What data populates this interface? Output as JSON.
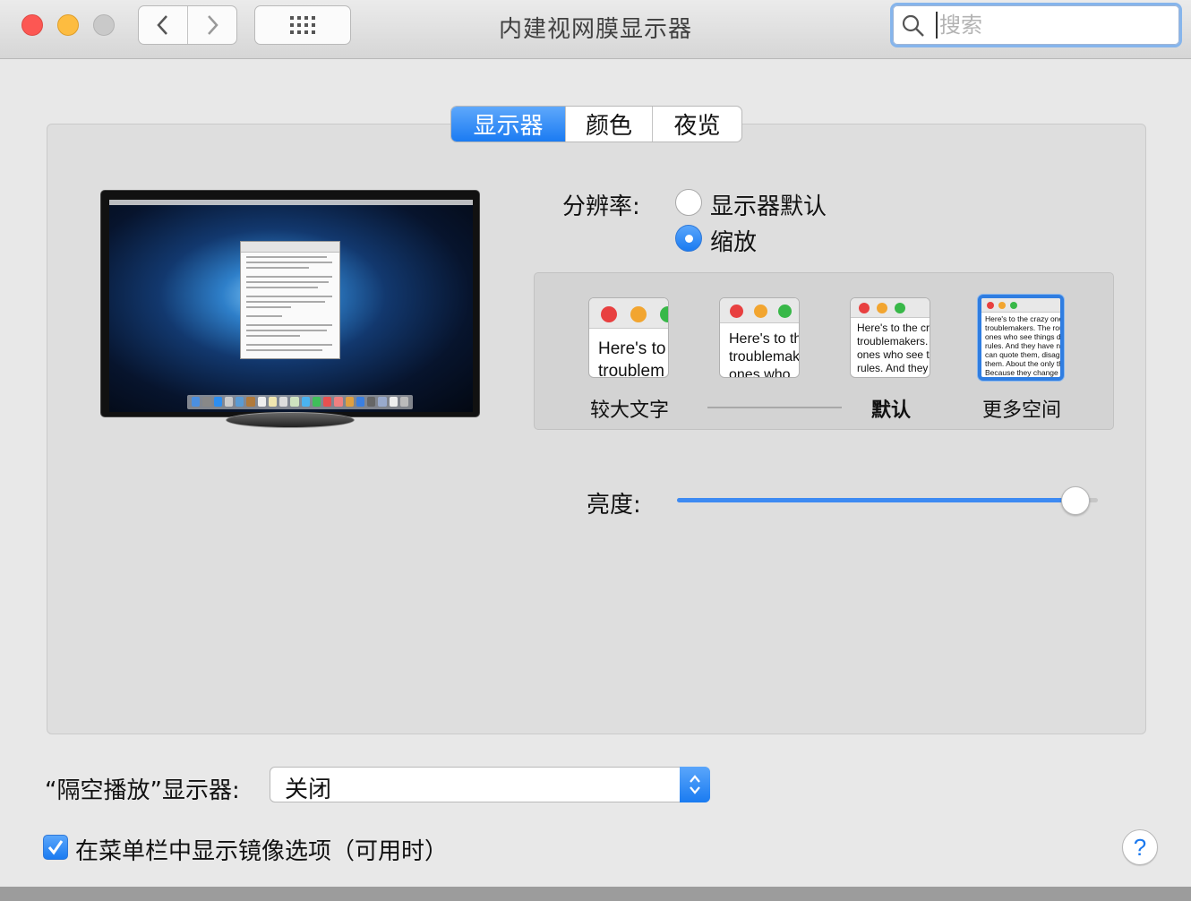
{
  "window": {
    "title": "内建视网膜显示器",
    "search_placeholder": "搜索"
  },
  "tabs": [
    {
      "label": "显示器",
      "active": true
    },
    {
      "label": "颜色",
      "active": false
    },
    {
      "label": "夜览",
      "active": false
    }
  ],
  "resolution": {
    "label": "分辨率:",
    "options": [
      {
        "label": "显示器默认",
        "selected": false
      },
      {
        "label": "缩放",
        "selected": true
      }
    ]
  },
  "scaling": {
    "options": [
      {
        "label": "较大文字",
        "preview_lines": [
          "Here's to",
          "troublem"
        ],
        "selected": false
      },
      {
        "label": "",
        "preview_lines": [
          "Here's to th",
          "troublemak",
          "ones who"
        ],
        "selected": false
      },
      {
        "label": "默认",
        "preview_lines": [
          "Here's to the cr",
          "troublemakers.",
          "ones who see t",
          "rules. And they"
        ],
        "selected": false
      },
      {
        "label": "更多空间",
        "preview_lines": [
          "Here's to the crazy one",
          "troublemakers. The rou",
          "ones who see things di",
          "rules. And they have no",
          "can quote them, disagr",
          "them. About the only th",
          "Because they change t"
        ],
        "selected": true
      }
    ]
  },
  "brightness": {
    "label": "亮度:",
    "value": 0.98
  },
  "airplay": {
    "label": "“隔空播放”显示器:",
    "selected": "关闭"
  },
  "mirroring": {
    "label": "在菜单栏中显示镜像选项（可用时）",
    "checked": true
  },
  "help": {
    "label": "?"
  },
  "colors": {
    "accent": "#1b7bf2",
    "close": "#fc5753",
    "minimize": "#fdbc40",
    "zoom_disabled": "#c9c9c9"
  }
}
